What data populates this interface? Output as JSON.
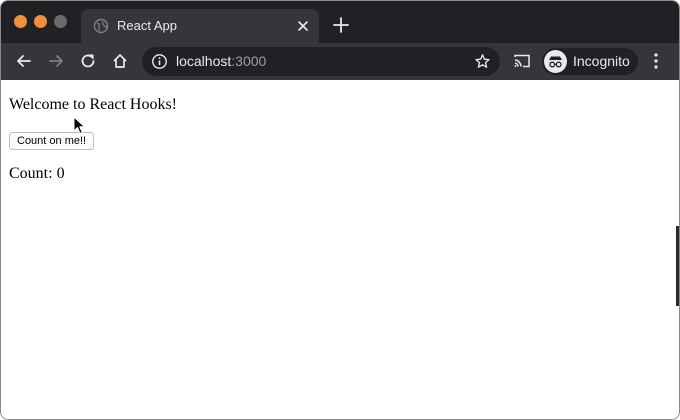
{
  "browser": {
    "tab": {
      "title": "React App"
    },
    "address": {
      "host": "localhost",
      "port": ":3000"
    },
    "profile": {
      "label": "Incognito"
    }
  },
  "page": {
    "heading": "Welcome to React Hooks!",
    "button_label": "Count on me!!",
    "count_text": "Count: 0"
  },
  "icons": {
    "close_dot": "traffic-close",
    "minimize_dot": "traffic-minimize",
    "maximize_dot": "traffic-maximize",
    "tab_favicon": "globe-icon",
    "tab_close": "close-icon",
    "new_tab": "plus-icon",
    "back": "back-arrow-icon",
    "forward": "forward-arrow-icon",
    "reload": "reload-icon",
    "home": "home-icon",
    "site_info": "info-icon",
    "bookmark": "star-icon",
    "cast": "cast-icon",
    "incognito_avatar": "incognito-icon",
    "menu": "kebab-menu-icon"
  },
  "colors": {
    "tabstrip": "#202124",
    "toolbar": "#35363a",
    "traffic_orange": "#f28f3b",
    "traffic_gray": "#6a6a6a",
    "text_light": "#e8eaed",
    "port_gray": "#9aa0a6"
  }
}
